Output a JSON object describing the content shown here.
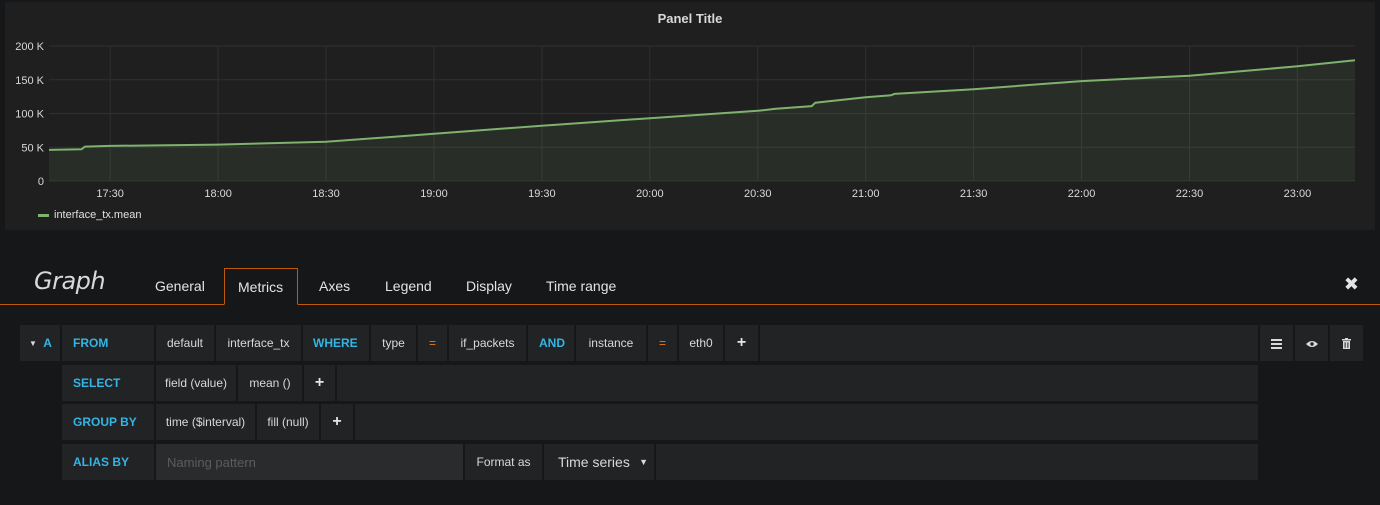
{
  "panel": {
    "title": "Panel Title"
  },
  "chart_data": {
    "type": "area",
    "title": "Panel Title",
    "x_ticks": [
      "17:30",
      "18:00",
      "18:30",
      "19:00",
      "19:30",
      "20:00",
      "20:30",
      "21:00",
      "21:30",
      "22:00",
      "22:30",
      "23:00"
    ],
    "y_ticks": [
      "0",
      "50 K",
      "100 K",
      "150 K",
      "200 K"
    ],
    "ylim": [
      0,
      200000
    ],
    "xlim": [
      "17:13",
      "23:16"
    ],
    "grid": true,
    "series": [
      {
        "name": "interface_tx.mean",
        "color": "#7eb26d",
        "x": [
          "17:13",
          "17:22",
          "17:23",
          "17:30",
          "18:00",
          "18:30",
          "19:00",
          "19:30",
          "20:00",
          "20:30",
          "20:35",
          "20:45",
          "20:46",
          "21:00",
          "21:07",
          "21:08",
          "21:30",
          "21:50",
          "22:00",
          "22:30",
          "22:45",
          "23:00",
          "23:16"
        ],
        "values": [
          46000,
          47000,
          51000,
          52000,
          54000,
          58000,
          70000,
          82000,
          93000,
          104000,
          107000,
          111000,
          116000,
          124000,
          127000,
          129000,
          136000,
          144000,
          148000,
          156000,
          163000,
          170000,
          179000
        ]
      }
    ],
    "legend_position": "bottom-left"
  },
  "editor": {
    "title": "Graph",
    "tabs": [
      "General",
      "Metrics",
      "Axes",
      "Legend",
      "Display",
      "Time range"
    ],
    "active_tab": "Metrics",
    "close_icon": "close-icon"
  },
  "query": {
    "ref_id": "A",
    "from_label": "FROM",
    "retention_policy": "default",
    "measurement": "interface_tx",
    "where_label": "WHERE",
    "tag1_key": "type",
    "tag1_op": "=",
    "tag1_value": "if_packets",
    "and_label": "AND",
    "tag2_key": "instance",
    "tag2_op": "=",
    "tag2_value": "eth0",
    "select_label": "SELECT",
    "select_field": "field (value)",
    "select_fn": "mean ()",
    "group_by_label": "GROUP BY",
    "group_time": "time ($interval)",
    "group_fill": "fill (null)",
    "alias_by_label": "ALIAS BY",
    "alias_placeholder": "Naming pattern",
    "format_as_label": "Format as",
    "format_as_value": "Time series",
    "plus": "+"
  }
}
